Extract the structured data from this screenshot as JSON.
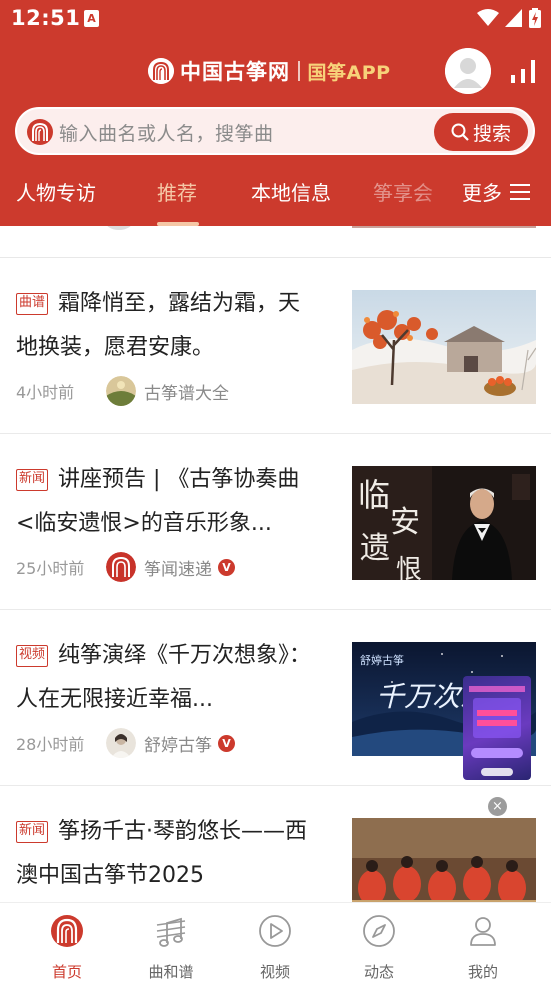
{
  "status_bar": {
    "time": "12:51",
    "notification_glyph": "A"
  },
  "header": {
    "logo_text": "中国古筝网",
    "logo_app": "国筝APP",
    "avatar_icon": "user-avatar-icon",
    "stats_icon": "bar-chart-icon"
  },
  "search": {
    "placeholder": "输入曲名或人名，搜筝曲",
    "button_label": "搜索"
  },
  "tabs": [
    {
      "label": "人物专访"
    },
    {
      "label": "推荐",
      "active": true
    },
    {
      "label": "本地信息"
    },
    {
      "label": "筝享会"
    }
  ],
  "more_tab": {
    "label": "更多",
    "icon": "menu-icon"
  },
  "feed": [
    {
      "badge": "曲谱",
      "title": "霜降悄至，露结为霜，天地换装，愿君安康。",
      "time": "4小时前",
      "source": "古筝谱大全",
      "verified": false
    },
    {
      "badge": "新闻",
      "title": "讲座预告 | 《古筝协奏曲<临安遗恨>的音乐形象...",
      "time": "25小时前",
      "source": "筝闻速递",
      "verified": true,
      "thumb_text": "临安遗恨"
    },
    {
      "badge": "视频",
      "title": "纯筝演绎《千万次想象》：人在无限接近幸福...",
      "time": "28小时前",
      "source": "舒婷古筝",
      "verified": true,
      "thumb_text": "千万次想"
    },
    {
      "badge": "新闻",
      "title": "筝扬千古·琴韵悠长——西澳中国古筝节2025",
      "time": "",
      "source": "",
      "verified": false
    }
  ],
  "verified_mark": "V",
  "float_close": "×",
  "bottom_nav": [
    {
      "label": "首页",
      "icon": "home-logo-icon",
      "active": true
    },
    {
      "label": "曲和谱",
      "icon": "music-score-icon"
    },
    {
      "label": "视频",
      "icon": "video-play-icon"
    },
    {
      "label": "动态",
      "icon": "compass-icon"
    },
    {
      "label": "我的",
      "icon": "profile-icon"
    }
  ],
  "colors": {
    "brand_red": "#cc3a2d",
    "accent_gold": "#f7d27a",
    "tab_active": "#f5c7a6"
  }
}
